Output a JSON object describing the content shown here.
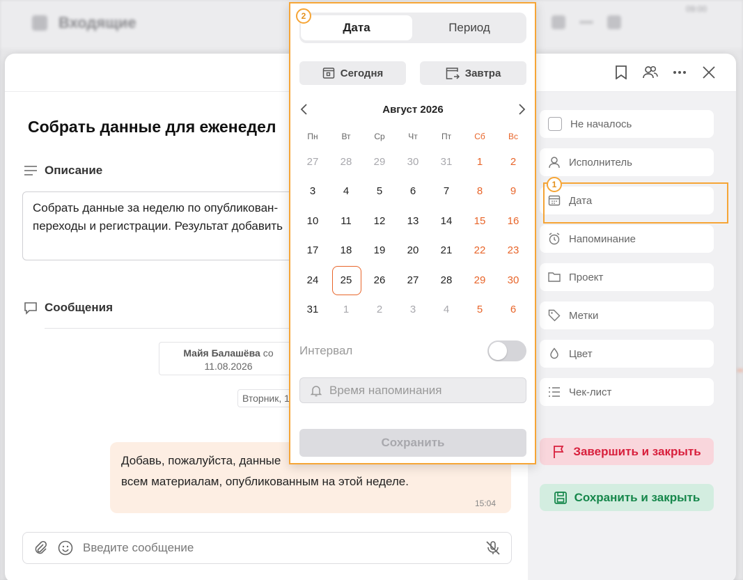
{
  "background": {
    "title": "Входящие",
    "counter": "09:00"
  },
  "task": {
    "title": "Собрать данные для еженедел",
    "description_label": "Описание",
    "description_text": "Собрать данные за неделю по опубликован-\nпереходы и регистрации. Результат добавить",
    "messages_label": "Сообщения",
    "system_message": {
      "author": "Майя Балашёва",
      "suffix": " со",
      "date": "11.08.2026"
    },
    "day_chip": "Вторник, 1",
    "bubble": {
      "text": "Добавь, пожалуйста, данные\nвсем материалам, опубликованным на этой неделе.",
      "time": "15:04"
    },
    "composer_placeholder": "Введите сообщение"
  },
  "sidebar": {
    "status": "Не началось",
    "items": [
      {
        "label": "Исполнитель",
        "icon": "person-icon"
      },
      {
        "label": "Дата",
        "icon": "calendar-icon"
      },
      {
        "label": "Напоминание",
        "icon": "alarm-icon"
      },
      {
        "label": "Проект",
        "icon": "folder-icon"
      },
      {
        "label": "Метки",
        "icon": "tag-icon"
      },
      {
        "label": "Цвет",
        "icon": "drop-icon"
      },
      {
        "label": "Чек-лист",
        "icon": "checklist-icon"
      }
    ],
    "finish_button": "Завершить и закрыть",
    "save_button": "Сохранить и закрыть"
  },
  "highlights": {
    "sidebar_date_badge": "1",
    "picker_badge": "2",
    "color": "#f6a536"
  },
  "picker": {
    "tab_date": "Дата",
    "tab_period": "Период",
    "today_button": "Сегодня",
    "tomorrow_button": "Завтра",
    "month": "Август 2026",
    "weekdays": [
      "Пн",
      "Вт",
      "Ср",
      "Чт",
      "Пт",
      "Сб",
      "Вс"
    ],
    "weeks": [
      [
        "27",
        "28",
        "29",
        "30",
        "31",
        "1",
        "2"
      ],
      [
        "3",
        "4",
        "5",
        "6",
        "7",
        "8",
        "9"
      ],
      [
        "10",
        "11",
        "12",
        "13",
        "14",
        "15",
        "16"
      ],
      [
        "17",
        "18",
        "19",
        "20",
        "21",
        "22",
        "23"
      ],
      [
        "24",
        "25",
        "26",
        "27",
        "28",
        "29",
        "30"
      ],
      [
        "31",
        "1",
        "2",
        "3",
        "4",
        "5",
        "6"
      ]
    ],
    "today": "25",
    "interval_label": "Интервал",
    "interval_on": false,
    "reminder_placeholder": "Время напоминания",
    "save_button": "Сохранить"
  },
  "colors": {
    "accent_orange": "#e8652a",
    "finish_red": "#d81f3c",
    "save_green": "#16874b"
  }
}
